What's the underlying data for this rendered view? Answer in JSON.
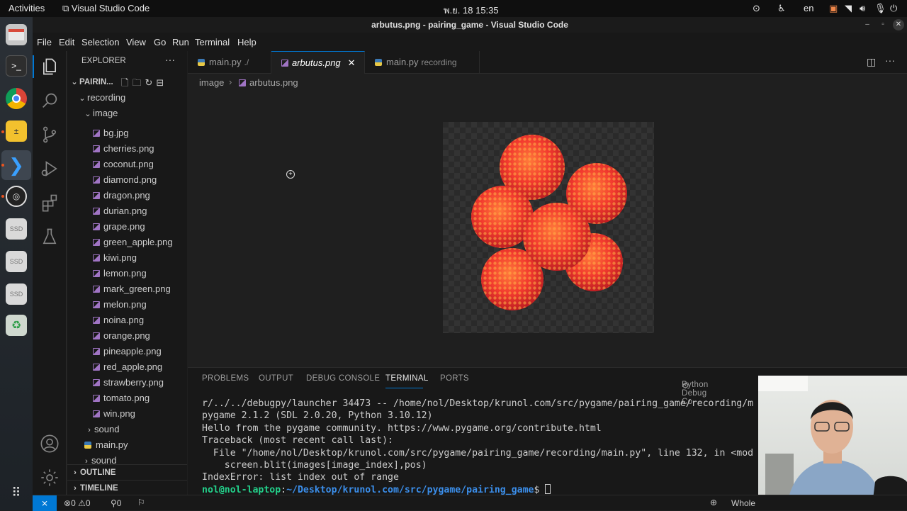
{
  "os": {
    "activities": "Activities",
    "app_name": "Visual Studio Code",
    "clock": "พ.ย. 18  15:35",
    "lang": "en"
  },
  "window": {
    "title": "arbutus.png - pairing_game - Visual Studio Code"
  },
  "menu": [
    "File",
    "Edit",
    "Selection",
    "View",
    "Go",
    "Run",
    "Terminal",
    "Help"
  ],
  "explorer": {
    "header": "EXPLORER",
    "project": "PAIRIN...",
    "folders": {
      "recording": "recording",
      "image": "image",
      "sound_inner": "sound",
      "sound_outer": "sound"
    },
    "files": [
      "bg.jpg",
      "cherries.png",
      "coconut.png",
      "diamond.png",
      "dragon.png",
      "durian.png",
      "grape.png",
      "green_apple.png",
      "kiwi.png",
      "lemon.png",
      "mark_green.png",
      "melon.png",
      "noina.png",
      "orange.png",
      "pineapple.png",
      "red_apple.png",
      "strawberry.png",
      "tomato.png",
      "win.png"
    ],
    "main_py": "main.py",
    "outline": "OUTLINE",
    "timeline": "TIMELINE"
  },
  "tabs": [
    {
      "label": "main.py",
      "desc": "./"
    },
    {
      "label": "arbutus.png",
      "desc": ""
    },
    {
      "label": "main.py",
      "desc": "recording"
    }
  ],
  "breadcrumb": {
    "folder": "image",
    "file": "arbutus.png"
  },
  "panel": {
    "tabs": [
      "PROBLEMS",
      "OUTPUT",
      "DEBUG CONSOLE",
      "TERMINAL",
      "PORTS"
    ],
    "active_tab": "TERMINAL",
    "debug_label": "Python Debug Co"
  },
  "terminal": {
    "lines": [
      "r/../../debugpy/launcher 34473 -- /home/nol/Desktop/krunol.com/src/pygame/pairing_game/recording/m",
      "pygame 2.1.2 (SDL 2.0.20, Python 3.10.12)",
      "Hello from the pygame community. https://www.pygame.org/contribute.html",
      "Traceback (most recent call last):",
      "  File \"/home/nol/Desktop/krunol.com/src/pygame/pairing_game/recording/main.py\", line 132, in <mod",
      "    screen.blit(images[image_index],pos)",
      "IndexError: list index out of range"
    ],
    "prompt_user": "nol@nol-laptop",
    "prompt_path": "~/Desktop/krunol.com/src/pygame/pairing_game",
    "prompt_suffix": "$ "
  },
  "statusbar": {
    "errors": "0",
    "warnings": "0",
    "ports": "0",
    "right_label": "Whole"
  },
  "colors": {
    "accent": "#0078d4",
    "editor_bg": "#1f1f1f",
    "sidebar_bg": "#181818",
    "fruit": "#e8312f"
  }
}
